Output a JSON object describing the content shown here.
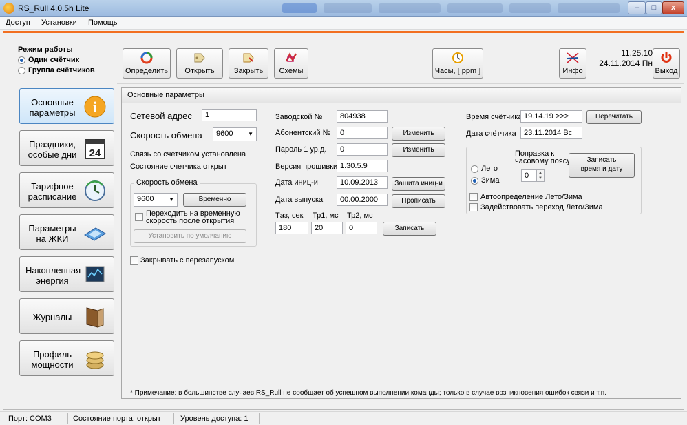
{
  "window": {
    "title": "RS_Rull 4.0.5h Lite",
    "minimize": "–",
    "maximize": "□",
    "close": "x"
  },
  "menu": [
    "Доступ",
    "Установки",
    "Помощь"
  ],
  "mode": {
    "title": "Режим работы",
    "single": "Один счётчик",
    "group": "Группа счётчиков"
  },
  "toolbar": {
    "identify": "Определить",
    "open": "Открыть",
    "close": "Закрыть",
    "schemes": "Схемы",
    "clock": "Часы, [ ppm ]",
    "info": "Инфо",
    "exit": "Выход",
    "time": "11.25.10",
    "date": "24.11.2014 Пн"
  },
  "nav": [
    {
      "line1": "Основные",
      "line2": "параметры"
    },
    {
      "line1": "Праздники,",
      "line2": "особые дни"
    },
    {
      "line1": "Тарифное",
      "line2": "расписание"
    },
    {
      "line1": "Параметры",
      "line2": "на ЖКИ"
    },
    {
      "line1": "Накопленная",
      "line2": "энергия"
    },
    {
      "line1": "Журналы",
      "line2": ""
    },
    {
      "line1": "Профиль",
      "line2": "мощности"
    }
  ],
  "nav_calendar_day": "24",
  "panel": {
    "title": "Основные параметры",
    "net_address_label": "Сетевой адрес",
    "net_address": "1",
    "baud_label": "Скорость обмена",
    "baud": "9600",
    "link_label": "Связь со счетчиком",
    "link_value": "установлена",
    "state_label": "Состояние счетчика",
    "state_value": "открыт",
    "baud_group_title": "Скорость обмена",
    "baud_temp": "9600",
    "temp_button": "Временно",
    "switch_temp_line1": "Переходить на временную",
    "switch_temp_line2": "скорость после открытия",
    "set_default": "Установить по умолчанию",
    "close_restart": "Закрывать с перезапуском",
    "serial_label": "Заводской №",
    "serial": "804938",
    "subscriber_label": "Абонентский №",
    "subscriber": "0",
    "change1": "Изменить",
    "pass_label": "Пароль 1 ур.д.",
    "pass": "0",
    "change2": "Изменить",
    "firmware_label": "Версия прошивки",
    "firmware": "1.30.5.9",
    "init_date_label": "Дата иниц-и",
    "init_date": "10.09.2013",
    "protect_init": "Защита иниц-и",
    "release_date_label": "Дата выпуска",
    "release_date": "00.00.2000",
    "write_release": "Прописать",
    "tau_label": "Тaз, сек",
    "tau": "180",
    "tp1_label": "Тр1, мс",
    "tp1": "20",
    "tp2_label": "Тр2, мс",
    "tp2": "0",
    "write": "Записать",
    "meter_time_label": "Время счётчика",
    "meter_time": "19.14.19 >>>",
    "reread": "Перечитать",
    "meter_date_label": "Дата счётчика",
    "meter_date": "23.11.2014 Вс",
    "summer": "Лето",
    "winter": "Зима",
    "tz_line1": "Поправка к",
    "tz_line2": "часовому поясу",
    "tz_value": "0",
    "write_time_line1": "Записать",
    "write_time_line2": "время и дату",
    "auto_dst": "Автоопределение Лето/Зима",
    "use_dst": "Задействовать переход Лето/Зима",
    "note": "* Примечание: в большинстве случаев RS_Rull не сообщает об успешном выполнении команды; только в случае возникновения ошибок связи и т.п."
  },
  "status": {
    "port": "Порт: COM3",
    "port_state": "Состояние порта: открыт",
    "access": "Уровень доступа: 1"
  }
}
